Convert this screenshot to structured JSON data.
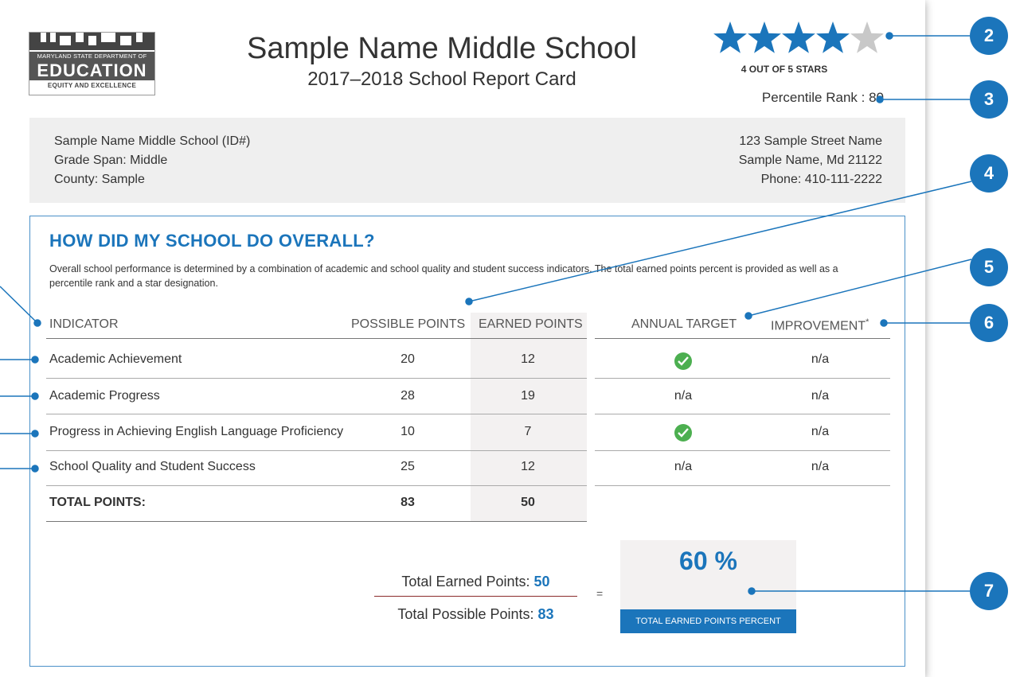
{
  "logo": {
    "department": "MARYLAND STATE DEPARTMENT OF",
    "education": "EDUCATION",
    "tagline": "EQUITY AND EXCELLENCE"
  },
  "header": {
    "school_name": "Sample Name Middle School",
    "report_title": "2017–2018 School Report Card",
    "stars_filled": 4,
    "stars_total": 5,
    "stars_label": "4 OUT OF 5 STARS",
    "percentile_rank": "Percentile Rank : 80"
  },
  "info": {
    "left": [
      "Sample Name Middle School (ID#)",
      "Grade Span: Middle",
      "County: Sample"
    ],
    "right": [
      "123 Sample Street Name",
      "Sample Name, Md  21122",
      "Phone: 410-111-2222"
    ]
  },
  "section": {
    "title": "HOW DID MY SCHOOL DO OVERALL?",
    "description": "Overall school performance is determined by a combination of academic and school quality and student success indicators. The total earned points percent is provided as well as a percentile rank and a star designation."
  },
  "table": {
    "headers": {
      "indicator": "INDICATOR",
      "possible": "POSSIBLE POINTS",
      "earned": "EARNED POINTS",
      "target": "ANNUAL TARGET",
      "improvement": "IMPROVEMENT",
      "improvement_mark": "*"
    },
    "rows": [
      {
        "indicator": "Academic Achievement",
        "possible": "20",
        "earned": "12",
        "target": "check-icon",
        "improvement": "n/a"
      },
      {
        "indicator": "Academic Progress",
        "possible": "28",
        "earned": "19",
        "target": "n/a",
        "improvement": "n/a"
      },
      {
        "indicator": "Progress in Achieving English Language Proficiency",
        "possible": "10",
        "earned": "7",
        "target": "check-icon",
        "improvement": "n/a"
      },
      {
        "indicator": "School Quality and Student Success",
        "possible": "25",
        "earned": "12",
        "target": "n/a",
        "improvement": "n/a"
      }
    ],
    "total": {
      "label": "TOTAL POINTS:",
      "possible": "83",
      "earned": "50"
    }
  },
  "summary": {
    "earned_label": "Total Earned Points:",
    "earned_value": "50",
    "possible_label": "Total Possible Points:",
    "possible_value": "83",
    "equals": "=",
    "percent": "60 %",
    "percent_label": "TOTAL EARNED POINTS PERCENT"
  },
  "callouts": [
    "2",
    "3",
    "4",
    "5",
    "6",
    "7"
  ],
  "colors": {
    "accent": "#1b75bb",
    "star_filled": "#1b75bb",
    "star_empty": "#c8c8c8",
    "check": "#4caf50"
  }
}
